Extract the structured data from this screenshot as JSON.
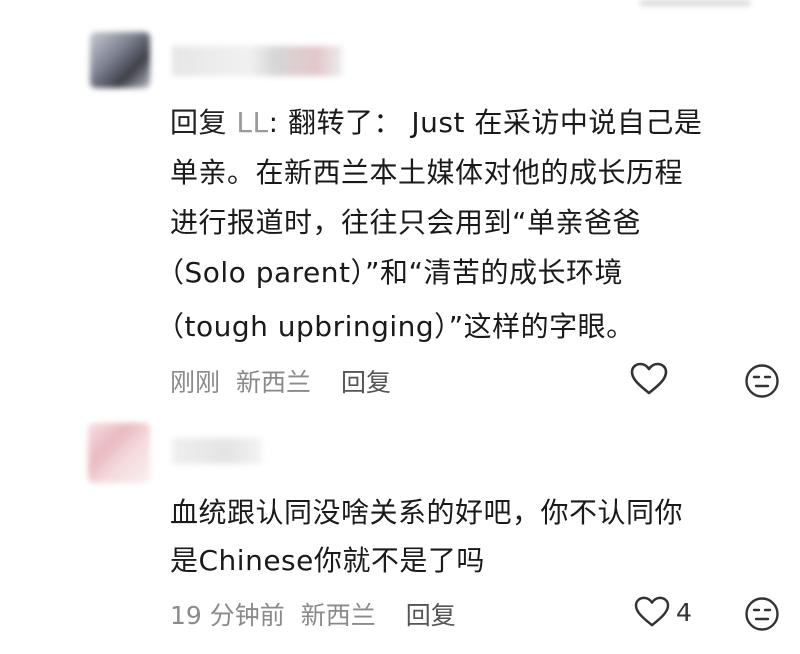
{
  "comments": [
    {
      "reply_prefix": "回复",
      "reply_target": "LL",
      "lines": [
        ": 翻转了： Just 在采访中说自己是",
        "单亲。在新西兰本土媒体对他的成长历程",
        "进行报道时，往往只会用到“单亲爸爸",
        "（Solo parent）”和“清苦的成长环境",
        "（tough upbringing）”这样的字眼。"
      ],
      "time": "刚刚",
      "location": "新西兰",
      "reply_label": "回复",
      "like_count": ""
    },
    {
      "lines": [
        "血统跟认同没啥关系的好吧，你不认同你",
        "是Chinese你就不是了吗"
      ],
      "time": "19 分钟前",
      "location": "新西兰",
      "reply_label": "回复",
      "like_count": "4"
    }
  ],
  "icons": {
    "like": "heart-outline-icon",
    "dislike": "neutral-face-icon"
  }
}
